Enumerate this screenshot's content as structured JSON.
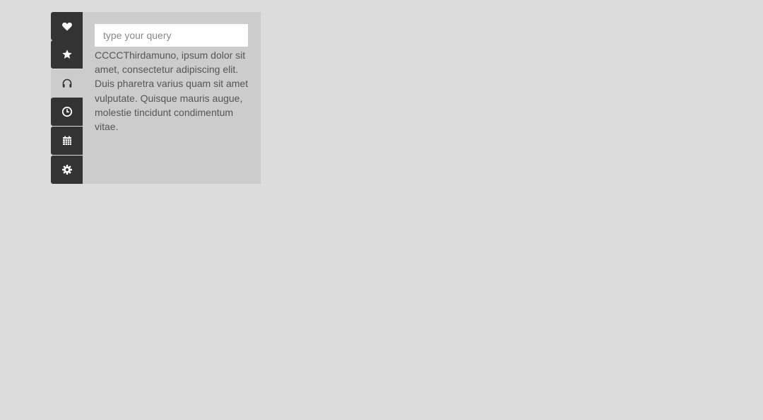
{
  "colors": {
    "page_background": "#dcdcdc",
    "tab_background": "#333333",
    "panel_background": "#cccccc",
    "icon_on_dark": "#ffffff",
    "icon_on_light": "#333333",
    "text": "#555555"
  },
  "tabs": [
    {
      "icon": "heart-icon",
      "active": false
    },
    {
      "icon": "star-icon",
      "active": false
    },
    {
      "icon": "headphones-icon",
      "active": true
    },
    {
      "icon": "clock-icon",
      "active": false
    },
    {
      "icon": "calendar-icon",
      "active": false
    },
    {
      "icon": "gear-icon",
      "active": false
    }
  ],
  "panel": {
    "search": {
      "placeholder": "type your query",
      "value": ""
    },
    "body_text": "CCCCThirdamuno, ipsum dolor sit amet, consectetur adipiscing elit. Duis pharetra varius quam sit amet vulputate. Quisque mauris augue, molestie tincidunt condimentum vitae."
  }
}
